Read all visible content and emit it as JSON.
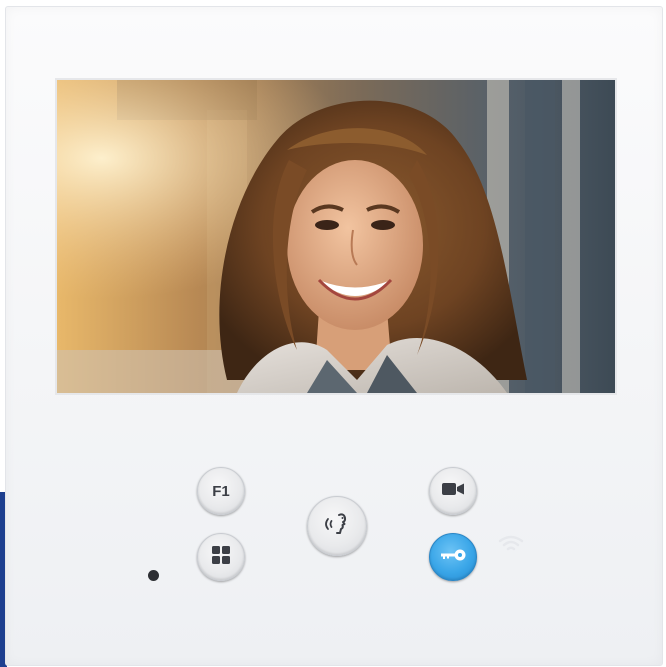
{
  "device": {
    "brand_text": "",
    "accent_color": "#3aa6e8",
    "panel_color": "#f4f5f7"
  },
  "screen": {
    "content": "live-video-feed",
    "subject": "visitor-at-door"
  },
  "buttons": {
    "f1": {
      "label": "F1"
    },
    "menu": {
      "icon": "grid-icon"
    },
    "talk": {
      "icon": "talk-icon"
    },
    "video": {
      "icon": "video-camera-icon"
    },
    "door": {
      "icon": "key-icon"
    }
  },
  "indicators": {
    "wifi": {
      "icon": "wifi-icon"
    },
    "microphone": {
      "icon": "mic-hole"
    }
  }
}
